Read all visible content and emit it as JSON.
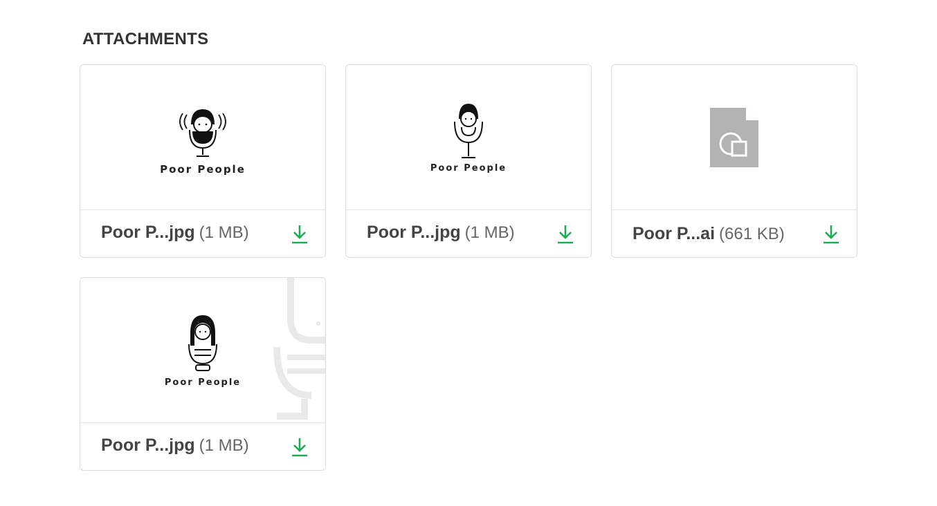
{
  "section": {
    "title": "ATTACHMENTS"
  },
  "attachments": [
    {
      "name": "Poor P...jpg",
      "size": "(1 MB)",
      "thumb_text": "Poor People",
      "thumb_type": "logo-waves"
    },
    {
      "name": "Poor P...jpg",
      "size": "(1 MB)",
      "thumb_text": "Poor People",
      "thumb_type": "logo-mic"
    },
    {
      "name": "Poor P...ai",
      "size": "(661 KB)",
      "thumb_text": "",
      "thumb_type": "generic-file-icon"
    },
    {
      "name": "Poor P...jpg",
      "size": "(1 MB)",
      "thumb_text": "Poor People",
      "thumb_type": "logo-stripes"
    }
  ],
  "colors": {
    "download": "#1fa85a",
    "file_icon": "#b3b3b3",
    "border": "#dcdcdc"
  },
  "icons": {
    "download": "download-arrow-icon",
    "file": "shapes-file-icon"
  }
}
